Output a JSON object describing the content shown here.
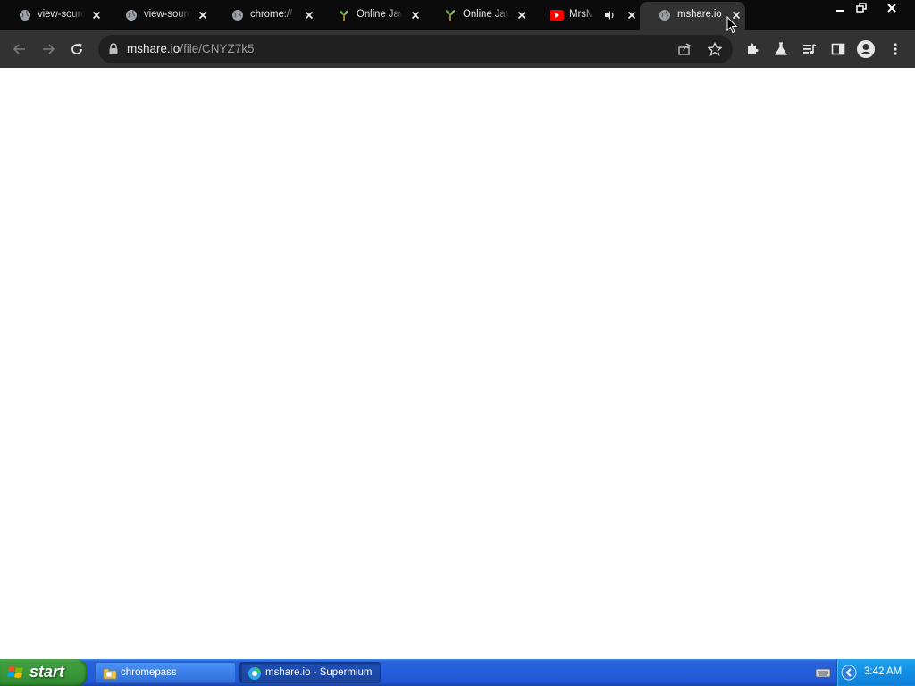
{
  "tabs": [
    {
      "title": "view-source:",
      "favicon": "globe-icon"
    },
    {
      "title": "view-source:",
      "favicon": "globe-icon"
    },
    {
      "title": "chrome://",
      "favicon": "globe-icon"
    },
    {
      "title": "Online Java",
      "favicon": "java-leaf-icon"
    },
    {
      "title": "Online Java",
      "favicon": "java-leaf-icon"
    },
    {
      "title": "MrsM",
      "favicon": "youtube-icon",
      "audio": "speaker-icon"
    },
    {
      "title": "mshare.io",
      "favicon": "globe-icon",
      "active": true
    }
  ],
  "toolbar": {
    "url_host": "mshare.io",
    "url_path": "/file/CNYZ7k5"
  },
  "taskbar": {
    "start_label": "start",
    "tasks": [
      {
        "label": "chromepass",
        "icon": "folder-icon"
      },
      {
        "label": "mshare.io - Supermium",
        "icon": "browser-icon",
        "active": true
      }
    ],
    "clock": "3:42 AM"
  },
  "colors": {
    "tabstrip": "#0b0b0b",
    "toolbar": "#323232",
    "omnibox": "#202020",
    "taskbar": "#245edb",
    "start": "#3c9d3c"
  }
}
